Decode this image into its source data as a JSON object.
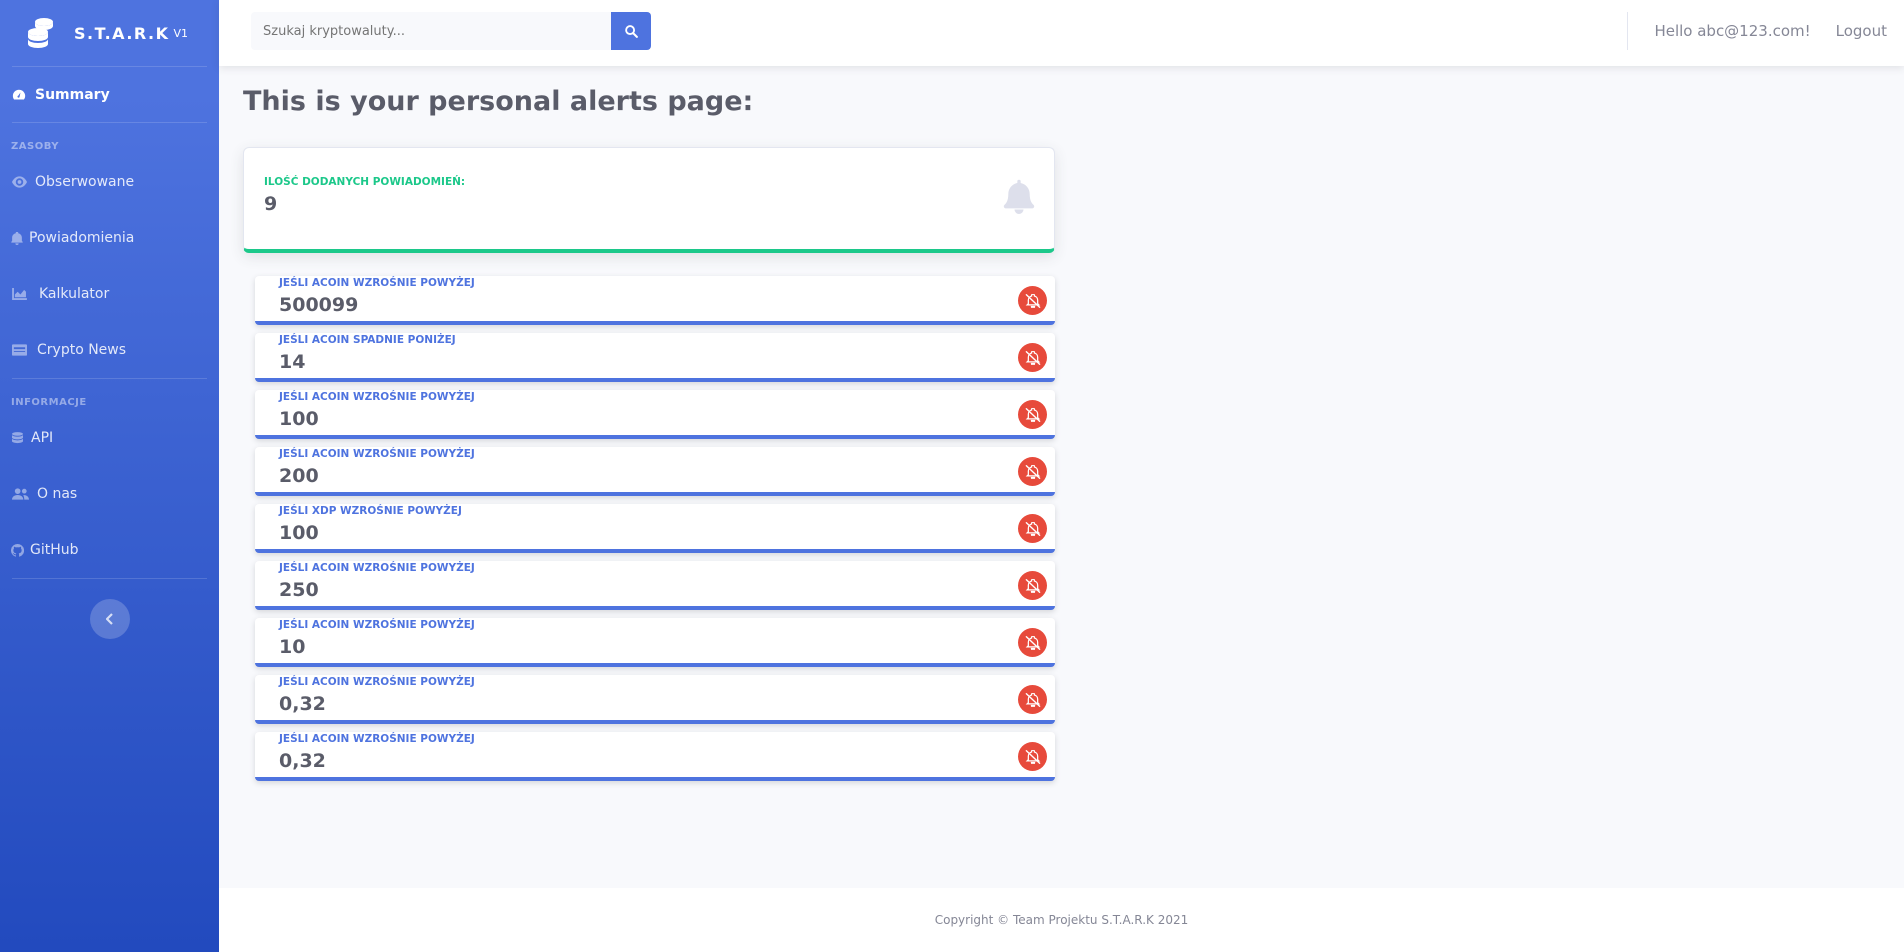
{
  "brand": {
    "name": "S.T.A.R.K",
    "version": "V1"
  },
  "sidebar": {
    "summary": "Summary",
    "heading_resources": "ZASOBY",
    "items_resources": [
      {
        "label": "Obserwowane",
        "icon": "eye-icon"
      },
      {
        "label": "Powiadomienia",
        "icon": "bell-icon"
      },
      {
        "label": "Kalkulator",
        "icon": "chart-area-icon"
      },
      {
        "label": "Crypto News",
        "icon": "newspaper-icon"
      }
    ],
    "heading_info": "INFORMACJE",
    "items_info": [
      {
        "label": "API",
        "icon": "database-icon"
      },
      {
        "label": "O nas",
        "icon": "users-icon"
      },
      {
        "label": "GitHub",
        "icon": "github-icon"
      }
    ]
  },
  "topbar": {
    "search_placeholder": "Szukaj kryptowaluty...",
    "greeting": "Hello abc@123.com!",
    "logout": "Logout"
  },
  "page": {
    "title": "This is your personal alerts page:",
    "stat_label": "Ilość dodanych powiadomień:",
    "stat_value": "9"
  },
  "alerts": [
    {
      "label": "Jeśli ACOIN wzrośnie powyżej",
      "value": "500099"
    },
    {
      "label": "Jeśli ACOIN spadnie poniżej",
      "value": "14"
    },
    {
      "label": "Jeśli ACOIN wzrośnie powyżej",
      "value": "100"
    },
    {
      "label": "Jeśli ACOIN wzrośnie powyżej",
      "value": "200"
    },
    {
      "label": "Jeśli XDP wzrośnie powyżej",
      "value": "100"
    },
    {
      "label": "Jeśli ACOIN wzrośnie powyżej",
      "value": "250"
    },
    {
      "label": "Jeśli ACOIN wzrośnie powyżej",
      "value": "10"
    },
    {
      "label": "Jeśli ACOIN wzrośnie powyżej",
      "value": "0,32"
    },
    {
      "label": "Jeśli ACOIN wzrośnie powyżej",
      "value": "0,32"
    }
  ],
  "footer": {
    "copyright": "Copyright © Team Projektu S.T.A.R.K 2021"
  },
  "colors": {
    "primary": "#4e73df",
    "success": "#1cc88a",
    "danger": "#e74a3b",
    "text": "#5a5c69"
  }
}
